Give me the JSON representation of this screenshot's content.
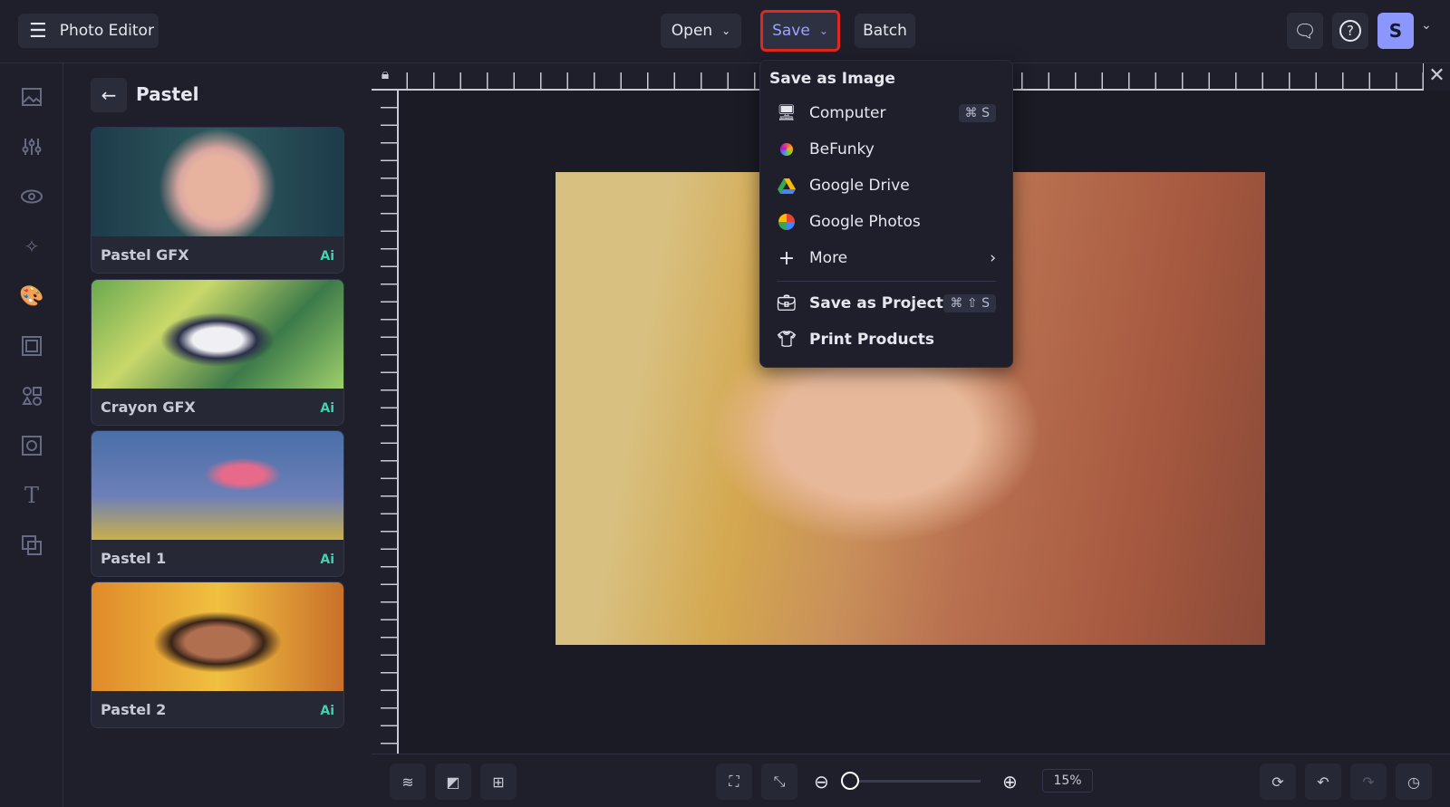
{
  "header": {
    "app_title": "Photo Editor",
    "open_label": "Open",
    "save_label": "Save",
    "batch_label": "Batch",
    "avatar_letter": "S"
  },
  "panel": {
    "title": "Pastel",
    "items": [
      {
        "label": "Pastel GFX",
        "badge": "Ai"
      },
      {
        "label": "Crayon GFX",
        "badge": "Ai"
      },
      {
        "label": "Pastel 1",
        "badge": "Ai"
      },
      {
        "label": "Pastel 2",
        "badge": "Ai"
      }
    ]
  },
  "save_menu": {
    "heading": "Save as Image",
    "items": [
      {
        "label": "Computer",
        "shortcut": "⌘ S"
      },
      {
        "label": "BeFunky"
      },
      {
        "label": "Google Drive"
      },
      {
        "label": "Google Photos"
      },
      {
        "label": "More"
      }
    ],
    "project": {
      "label": "Save as Project",
      "shortcut": "⌘ ⇧ S"
    },
    "print": {
      "label": "Print Products"
    }
  },
  "bottom": {
    "zoom_value": "15%",
    "zoom_slider_fraction": 0.0
  },
  "colors": {
    "accent": "#8c96ff",
    "highlight": "#e0281e",
    "ai_badge": "#3fd3b0"
  }
}
